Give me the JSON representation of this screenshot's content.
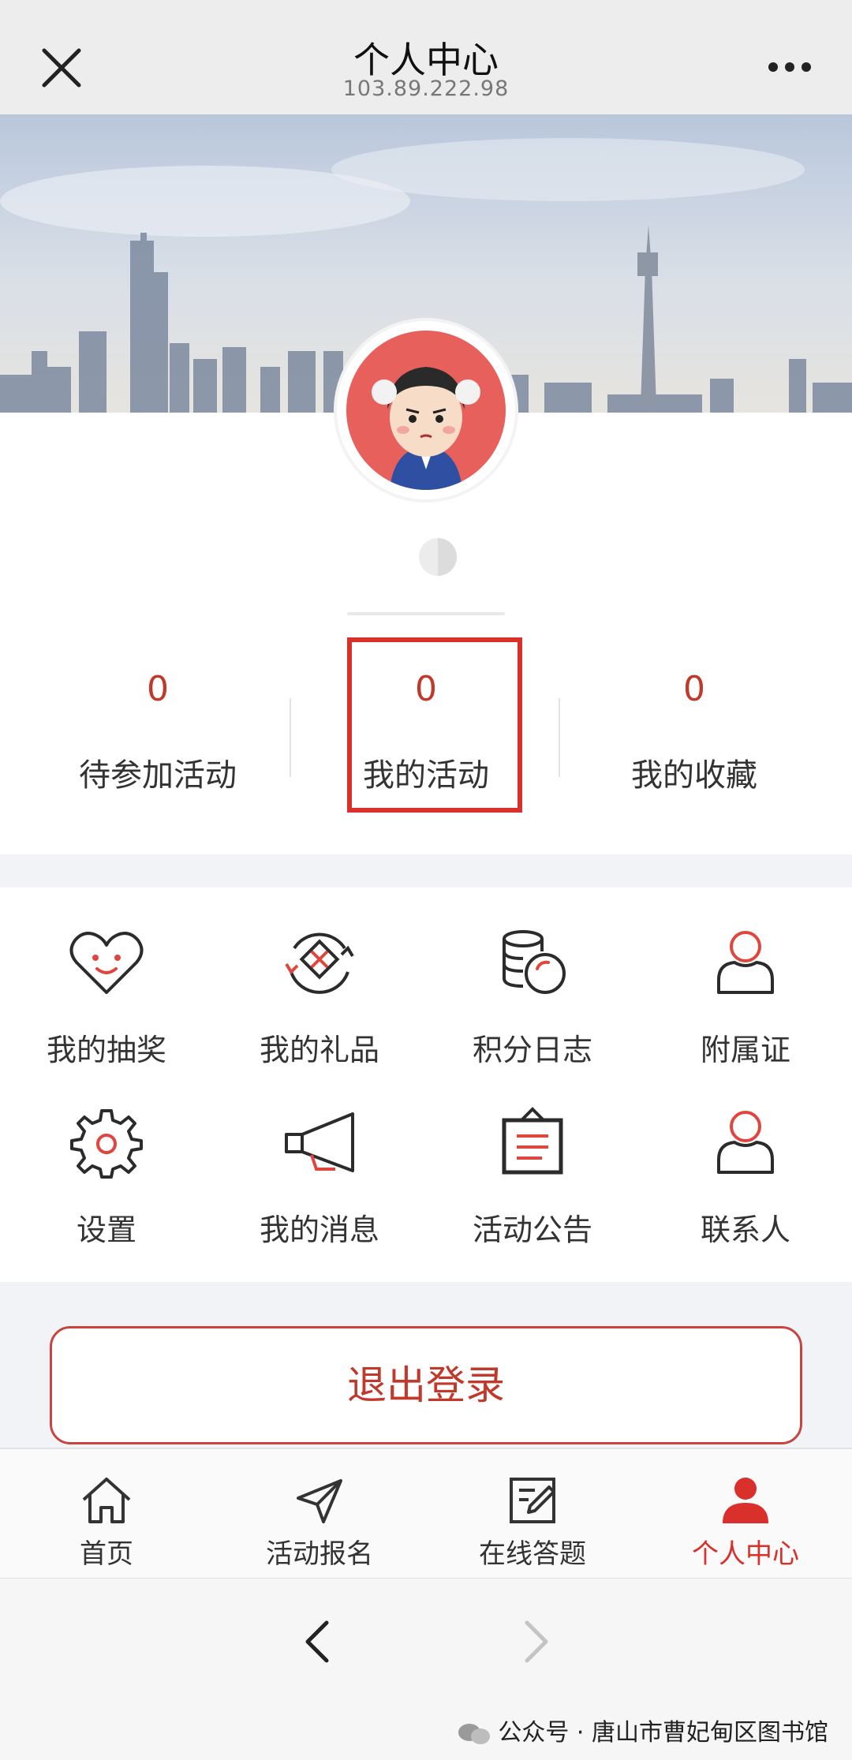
{
  "header": {
    "title": "个人中心",
    "subtitle": "103.89.222.98"
  },
  "stats": [
    {
      "value": "0",
      "label": "待参加活动"
    },
    {
      "value": "0",
      "label": "我的活动"
    },
    {
      "value": "0",
      "label": "我的收藏"
    }
  ],
  "menu": [
    {
      "label": "我的抽奖",
      "icon": "heart-smile-icon"
    },
    {
      "label": "我的礼品",
      "icon": "gift-icon"
    },
    {
      "label": "积分日志",
      "icon": "coins-icon"
    },
    {
      "label": "附属证",
      "icon": "person-icon"
    },
    {
      "label": "设置",
      "icon": "gear-icon"
    },
    {
      "label": "我的消息",
      "icon": "megaphone-icon"
    },
    {
      "label": "活动公告",
      "icon": "notice-board-icon"
    },
    {
      "label": "联系人",
      "icon": "contact-icon"
    }
  ],
  "logout_label": "退出登录",
  "tabs": [
    {
      "label": "首页",
      "icon": "home-icon",
      "active": false
    },
    {
      "label": "活动报名",
      "icon": "send-icon",
      "active": false
    },
    {
      "label": "在线答题",
      "icon": "edit-icon",
      "active": false
    },
    {
      "label": "个人中心",
      "icon": "user-icon",
      "active": true
    }
  ],
  "watermark": "公众号 · 唐山市曹妃甸区图书馆",
  "colors": {
    "accent": "#d9302b",
    "icon_dark": "#2b2b2b",
    "icon_red": "#e0463e"
  }
}
